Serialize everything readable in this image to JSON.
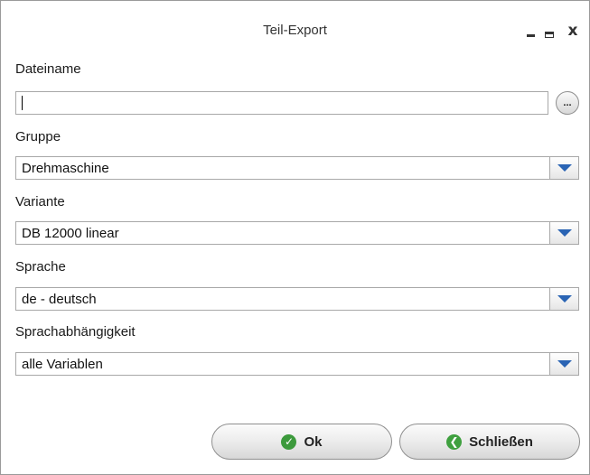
{
  "window": {
    "title": "Teil-Export",
    "minimize_icon": "minimize-icon",
    "maximize_icon": "maximize-icon",
    "close_icon": "close-icon"
  },
  "form": {
    "filename": {
      "label": "Dateiname",
      "value": "",
      "browse_label": "..."
    },
    "group": {
      "label": "Gruppe",
      "selected": "Drehmaschine"
    },
    "variant": {
      "label": "Variante",
      "selected": "DB 12000 linear"
    },
    "language": {
      "label": "Sprache",
      "selected": "de - deutsch"
    },
    "language_dependency": {
      "label": "Sprachabhängigkeit",
      "selected": "alle Variablen"
    }
  },
  "buttons": {
    "ok_label": "Ok",
    "ok_icon": "check-circle-icon",
    "close_label": "Schließen",
    "close_icon": "back-arrow-circle-icon"
  },
  "colors": {
    "dropdown_arrow": "#2a64b4",
    "ok_icon": "#3c9a3c",
    "close_icon": "#3fa03f"
  }
}
